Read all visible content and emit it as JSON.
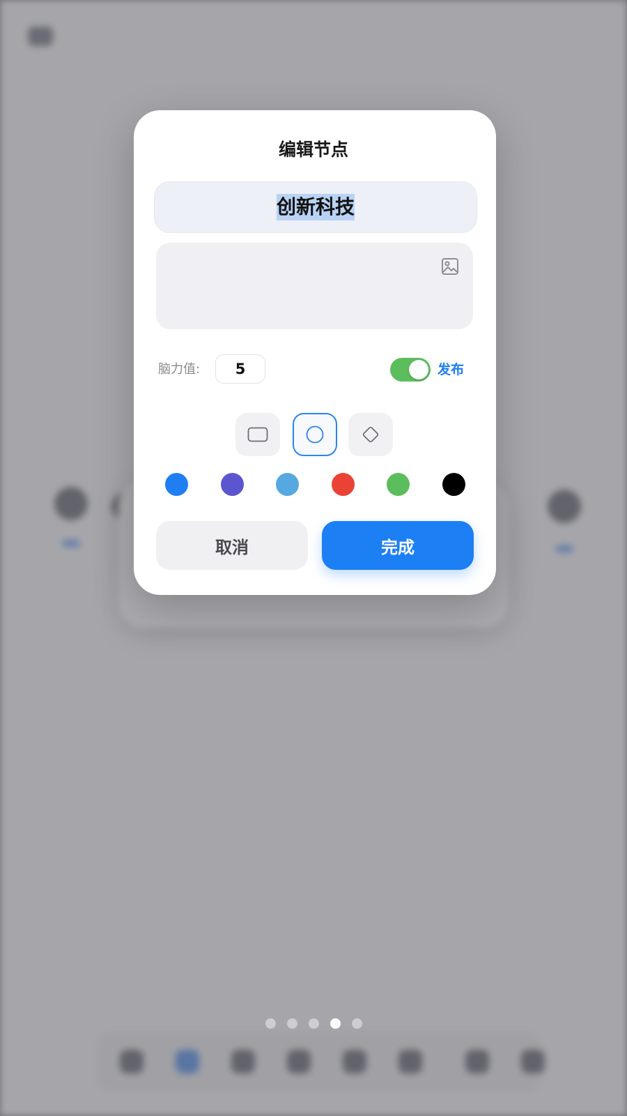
{
  "dialog": {
    "title": "编辑节点",
    "name_value": "创新科技",
    "brain_label": "脑力值:",
    "brain_value": "5",
    "publish_label": "发布",
    "publish_enabled": true,
    "shapes": [
      {
        "name": "rounded-rectangle",
        "selected": false
      },
      {
        "name": "circle",
        "selected": true
      },
      {
        "name": "diamond",
        "selected": false
      }
    ],
    "colors": [
      "#1e7ef2",
      "#5b56d0",
      "#56a8e0",
      "#ea4335",
      "#5cbd5c",
      "#000000"
    ],
    "cancel_label": "取消",
    "done_label": "完成"
  },
  "pager": {
    "count": 5,
    "active_index": 3
  },
  "theme": {
    "accent": "#1c7ff4",
    "toggle_on": "#5cbd5c"
  }
}
